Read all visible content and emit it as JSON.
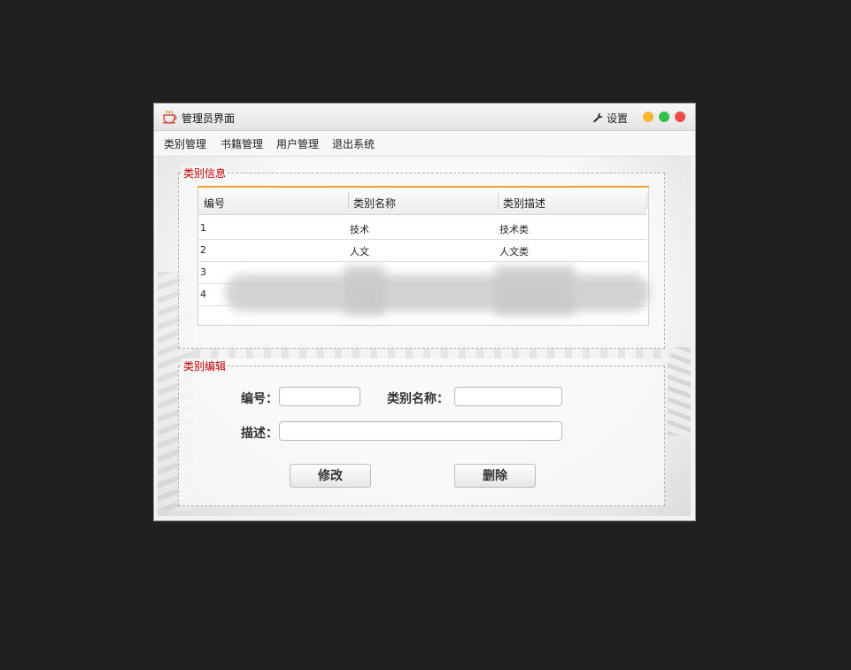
{
  "window": {
    "title": "管理员界面",
    "app_icon": "coffee-cup-icon",
    "settings_icon": "wrench-icon",
    "settings_label": "设置"
  },
  "menu": {
    "items": [
      {
        "label": "类别管理"
      },
      {
        "label": "书籍管理"
      },
      {
        "label": "用户管理"
      },
      {
        "label": "退出系统"
      }
    ]
  },
  "category_info": {
    "legend": "类别信息",
    "columns": [
      "编号",
      "类别名称",
      "类别描述"
    ],
    "rows": [
      {
        "id": "1",
        "name": "技术",
        "desc": "技术类"
      },
      {
        "id": "2",
        "name": "人文",
        "desc": "人文类"
      },
      {
        "id": "3",
        "name": "",
        "desc": ""
      },
      {
        "id": "4",
        "name": "",
        "desc": ""
      }
    ]
  },
  "category_edit": {
    "legend": "类别编辑",
    "id_label": "编号：",
    "name_label": "类别名称：",
    "desc_label": "描述：",
    "id_value": "",
    "name_value": "",
    "desc_value": "",
    "update_button": "修改",
    "delete_button": "删除"
  },
  "colors": {
    "accent_orange": "#f0a030",
    "legend_red": "#c00000",
    "dot_yellow": "#f5b731",
    "dot_green": "#35c04a",
    "dot_red": "#ef4b4b"
  }
}
